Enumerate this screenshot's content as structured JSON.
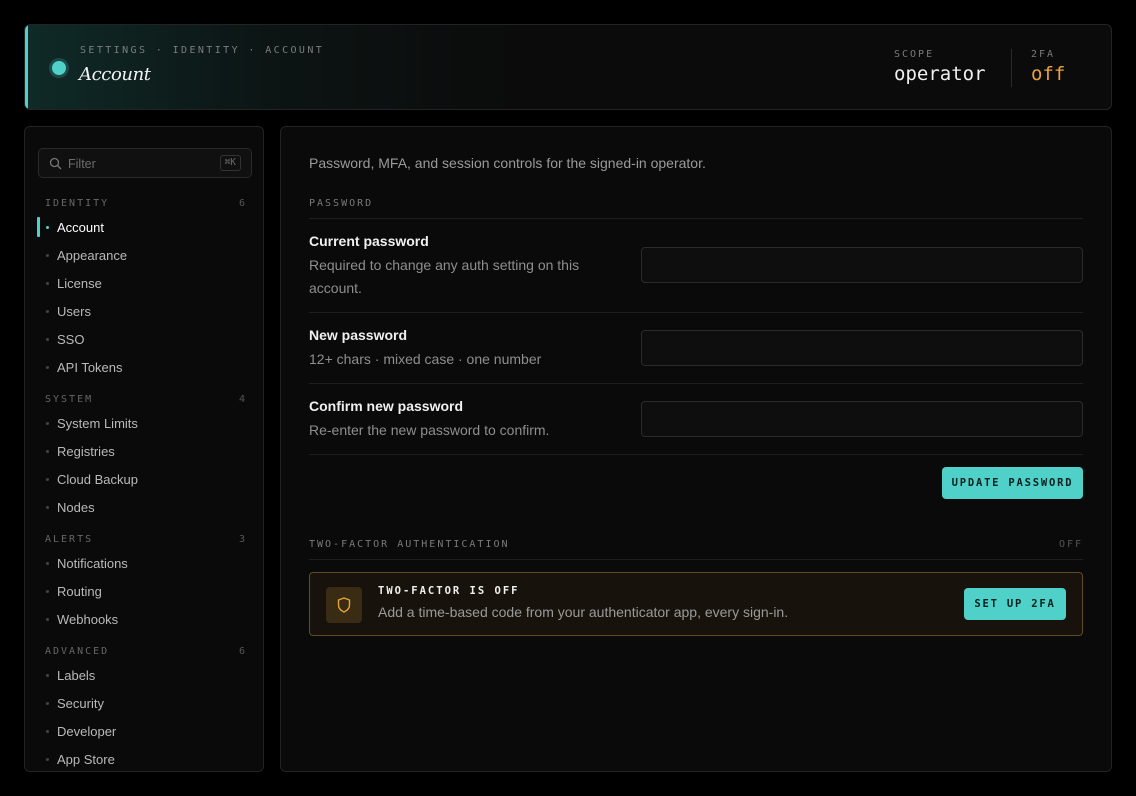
{
  "header": {
    "breadcrumb": "SETTINGS · IDENTITY · ACCOUNT",
    "title": "Account",
    "scope_label": "SCOPE",
    "scope_value": "operator",
    "twofa_label": "2FA",
    "twofa_value": "off"
  },
  "sidebar": {
    "filter_placeholder": "Filter",
    "filter_shortcut": "⌘K",
    "groups": [
      {
        "label": "IDENTITY",
        "count": "6",
        "items": [
          "Account",
          "Appearance",
          "License",
          "Users",
          "SSO",
          "API Tokens"
        ]
      },
      {
        "label": "SYSTEM",
        "count": "4",
        "items": [
          "System Limits",
          "Registries",
          "Cloud Backup",
          "Nodes"
        ]
      },
      {
        "label": "ALERTS",
        "count": "3",
        "items": [
          "Notifications",
          "Routing",
          "Webhooks"
        ]
      },
      {
        "label": "ADVANCED",
        "count": "6",
        "items": [
          "Labels",
          "Security",
          "Developer",
          "App Store"
        ]
      }
    ],
    "active_item": "Account"
  },
  "main": {
    "lede": "Password, MFA, and session controls for the signed-in operator.",
    "password_section": {
      "heading": "PASSWORD",
      "fields": [
        {
          "title": "Current password",
          "help": "Required to change any auth setting on this account.",
          "value": ""
        },
        {
          "title": "New password",
          "help": "12+ chars · mixed case · one number",
          "value": ""
        },
        {
          "title": "Confirm new password",
          "help": "Re-enter the new password to confirm.",
          "value": ""
        }
      ],
      "update_button": "UPDATE PASSWORD"
    },
    "twofa_section": {
      "heading": "TWO-FACTOR AUTHENTICATION",
      "status": "OFF",
      "card_title": "TWO-FACTOR IS OFF",
      "card_desc": "Add a time-based code from your authenticator app, every sign-in.",
      "setup_button": "SET UP 2FA"
    }
  },
  "colors": {
    "accent": "#4fd1c9",
    "warning": "#e8a33c",
    "background": "#000000"
  },
  "icons": [
    "status-dot",
    "search-icon",
    "shield-icon"
  ]
}
